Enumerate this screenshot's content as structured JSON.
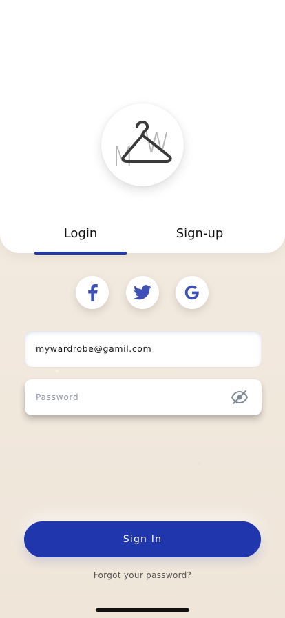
{
  "logo": {
    "letter_m": "M",
    "letter_w": "W"
  },
  "tabs": [
    {
      "label": "Login",
      "active": true
    },
    {
      "label": "Sign-up",
      "active": false
    }
  ],
  "social": [
    {
      "icon": "facebook-icon"
    },
    {
      "icon": "twitter-icon"
    },
    {
      "icon": "google-icon"
    }
  ],
  "form": {
    "email_value": "mywardrobe@gamil.com",
    "password_placeholder": "Password",
    "password_toggle_icon": "eye-off-icon"
  },
  "actions": {
    "sign_in_label": "Sign In",
    "forgot_label": "Forgot your password?"
  },
  "colors": {
    "accent": "#1f36ad",
    "tab_indicator": "#2239a8",
    "social_icon": "#3f51b5",
    "background": "#f3ebe1"
  }
}
